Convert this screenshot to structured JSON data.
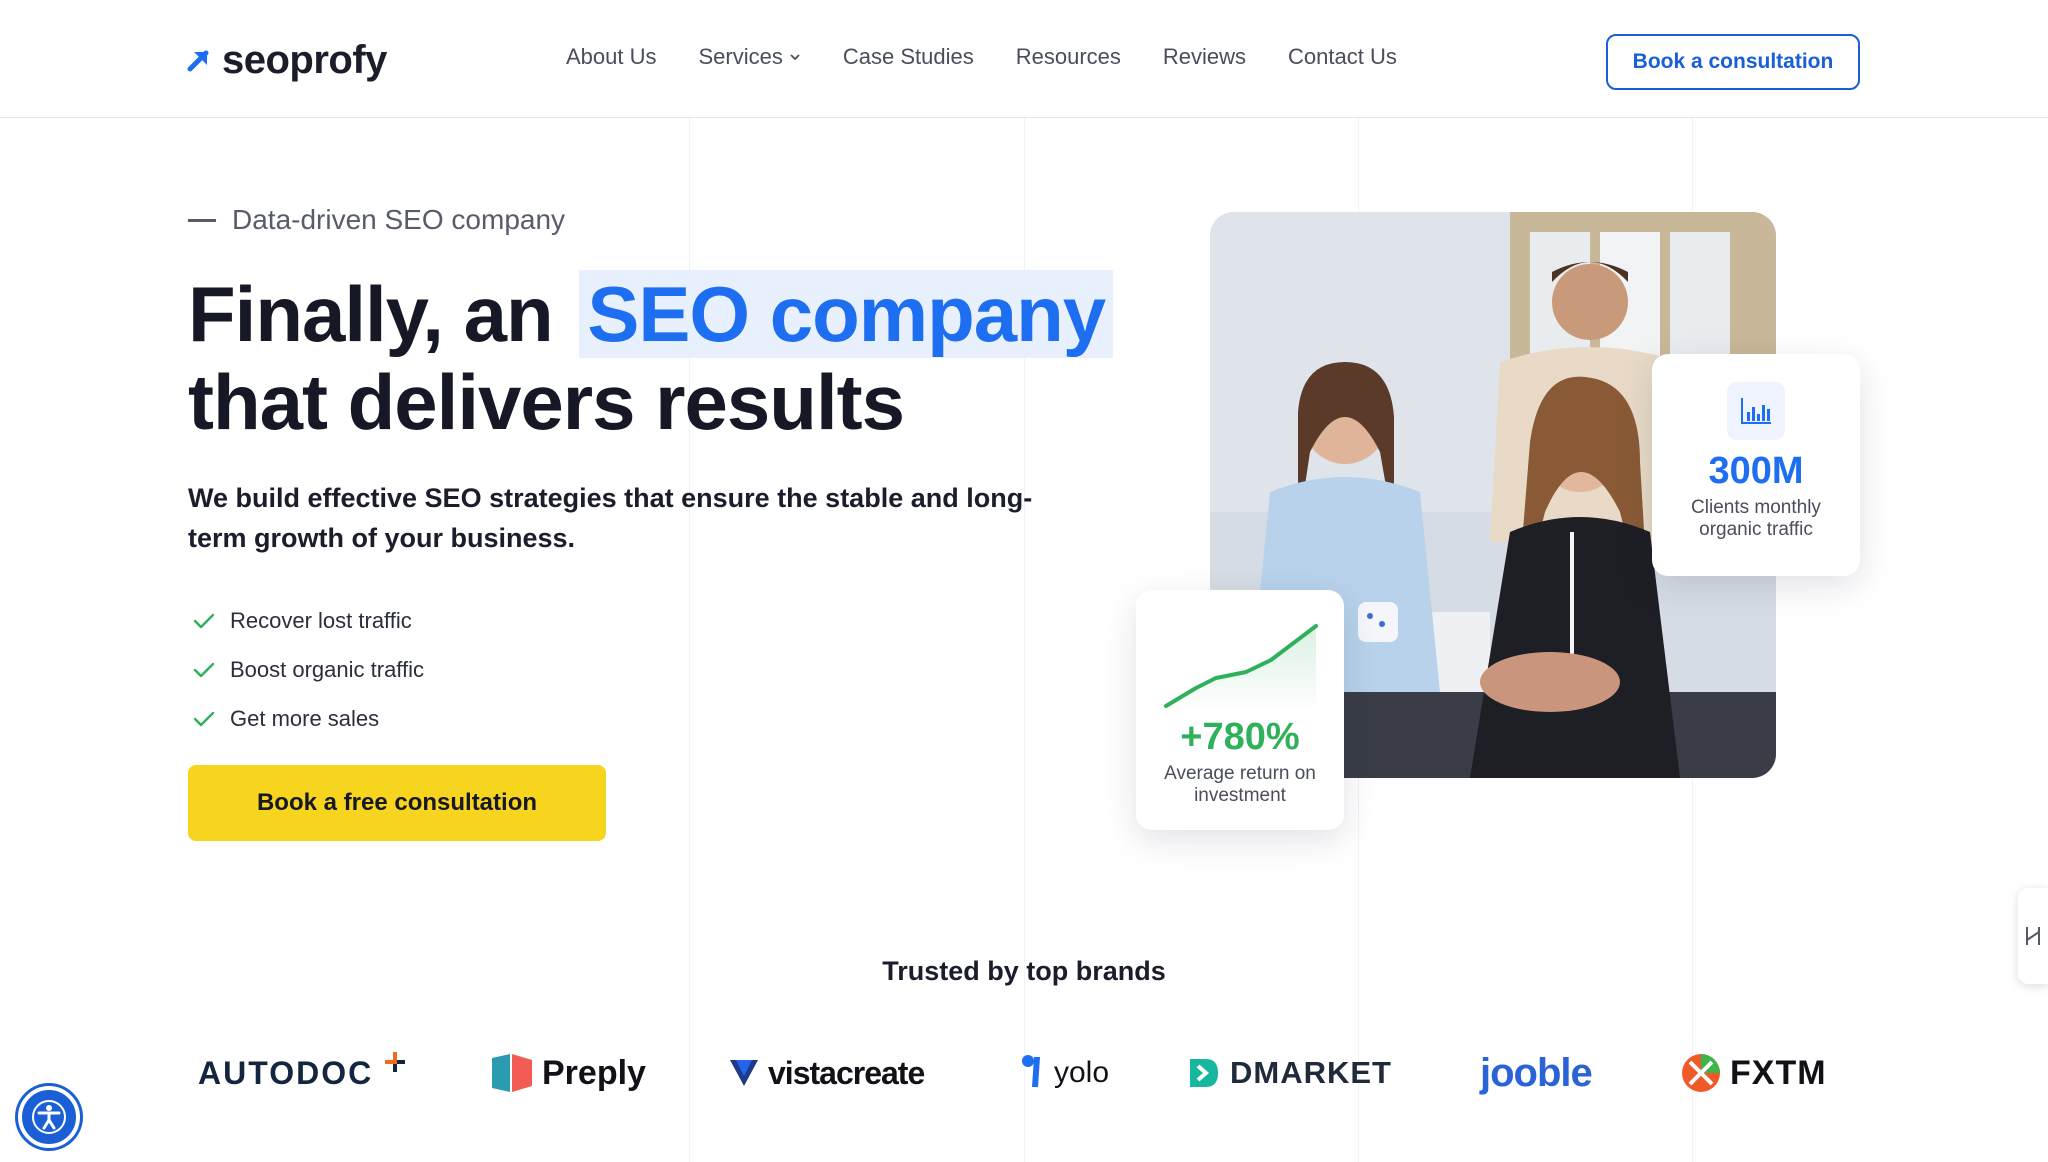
{
  "header": {
    "logo_text": "seoprofy",
    "nav": [
      {
        "label": "About Us"
      },
      {
        "label": "Services",
        "has_dropdown": true
      },
      {
        "label": "Case Studies"
      },
      {
        "label": "Resources"
      },
      {
        "label": "Reviews"
      },
      {
        "label": "Contact Us"
      }
    ],
    "cta_label": "Book a consultation"
  },
  "hero": {
    "eyebrow": "Data-driven SEO company",
    "headline_prefix": "Finally, an",
    "headline_highlight": "SEO company",
    "headline_line2": "that delivers results",
    "subheadline": "We build effective SEO strategies that ensure the stable and long-term growth of your business.",
    "benefits": [
      "Recover lost traffic",
      "Boost organic traffic",
      "Get more sales"
    ],
    "cta_label": "Book a free consultation",
    "stats": [
      {
        "value": "300M",
        "label": "Clients monthly organic traffic",
        "icon": "bar-chart-icon"
      },
      {
        "value": "+780%",
        "label": "Average return on investment",
        "icon": "growth-line-icon"
      }
    ]
  },
  "brands": {
    "title": "Trusted by top brands",
    "items": [
      "AUTODOC",
      "Preply",
      "vistacreate",
      "yolo",
      "DMARKET",
      "jooble",
      "FXTM"
    ]
  },
  "colors": {
    "accent_blue": "#1D6EF0",
    "cta_yellow": "#F7D51F",
    "check_green": "#2FB15C",
    "text_dark": "#161826"
  }
}
